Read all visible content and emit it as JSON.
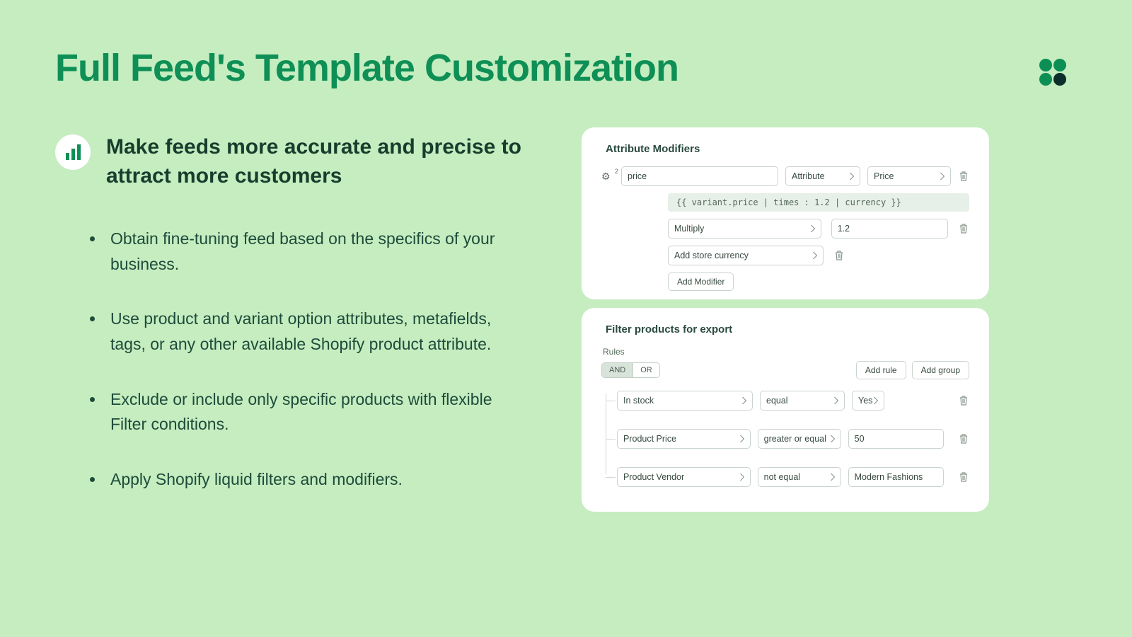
{
  "title": "Full Feed's Template Customization",
  "subtitle": "Make feeds more accurate and precise to attract more customers",
  "bullets": [
    "Obtain fine-tuning feed based on the specifics of your business.",
    "Use product and variant option attributes, metafields, tags, or any other available Shopify product attribute.",
    "Exclude or include only specific products with flexible Filter conditions.",
    "Apply Shopify liquid filters and modifiers."
  ],
  "attr_panel": {
    "heading": "Attribute Modifiers",
    "gear_badge": "2",
    "field": "price",
    "type_select": "Attribute",
    "value_select": "Price",
    "liquid": "{{ variant.price | times : 1.2 | currency }}",
    "op_select": "Multiply",
    "op_value": "1.2",
    "extra_select": "Add store currency",
    "add_button": "Add Modifier"
  },
  "filter_panel": {
    "heading": "Filter products for export",
    "rules_label": "Rules",
    "logic": {
      "and": "AND",
      "or": "OR",
      "active": "AND"
    },
    "add_rule": "Add rule",
    "add_group": "Add group",
    "rows": [
      {
        "field": "In stock",
        "op": "equal",
        "value": "Yes"
      },
      {
        "field": "Product Price",
        "op": "greater or equal",
        "value": "50"
      },
      {
        "field": "Product Vendor",
        "op": "not equal",
        "value": "Modern Fashions"
      }
    ]
  }
}
